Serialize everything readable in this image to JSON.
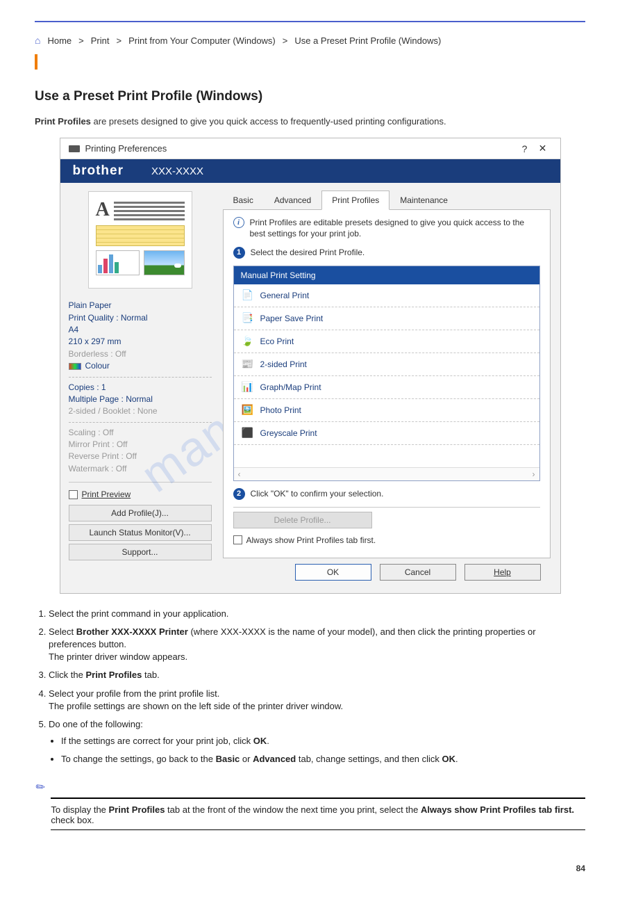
{
  "breadcrumb": {
    "root": "Home",
    "sep": ">",
    "cat": "Print",
    "sub": "Print from Your Computer (Windows)",
    "leaf": "Use a Preset Print Profile (Windows)"
  },
  "heading": "Use a Preset Print Profile (Windows)",
  "desc_pre": "Print Profiles",
  "desc_post": " are presets designed to give you quick access to frequently-used printing configurations.",
  "dialog": {
    "title": "Printing Preferences",
    "brand": "brother",
    "model": "XXX-XXXX",
    "summary": {
      "paper": "Plain Paper",
      "quality": "Print Quality : Normal",
      "size": "A4",
      "dims": "210 x 297 mm",
      "borderless": "Borderless : Off",
      "colour": "Colour",
      "copies": "Copies : 1",
      "multi": "Multiple Page : Normal",
      "booklet": "2-sided / Booklet : None",
      "scaling": "Scaling : Off",
      "mirror": "Mirror Print : Off",
      "reverse": "Reverse Print : Off",
      "watermark": "Watermark : Off"
    },
    "printPreview": "Print Preview",
    "addProfile": "Add Profile(J)...",
    "launchMonitor": "Launch Status Monitor(V)...",
    "support": "Support...",
    "tabs": {
      "basic": "Basic",
      "advanced": "Advanced",
      "profiles": "Print Profiles",
      "maint": "Maintenance"
    },
    "infoText": "Print Profiles are editable presets designed to give you quick access to the best settings for your print job.",
    "step1": "Select the desired Print Profile.",
    "step2": "Click \"OK\" to confirm your selection.",
    "profilesList": {
      "p0": "Manual Print Setting",
      "p1": "General Print",
      "p2": "Paper Save Print",
      "p3": "Eco Print",
      "p4": "2-sided Print",
      "p5": "Graph/Map Print",
      "p6": "Photo Print",
      "p7": "Greyscale Print"
    },
    "delete": "Delete Profile...",
    "always": "Always show Print Profiles tab first.",
    "ok": "OK",
    "cancel": "Cancel",
    "help": "Help"
  },
  "watermark": "manualshive.com",
  "steps": {
    "s1a": "Select the print command in your application.",
    "s2a": "Select ",
    "s2b": "Brother XXX-XXXX Printer",
    "s2c": " (where XXX-XXXX is the name of your model), and then click the printing properties or preferences button.",
    "s2d": "The printer driver window appears.",
    "s3a": "Click the ",
    "s3b": "Print Profiles",
    "s3c": " tab.",
    "s4a": "Select your profile from the print profile list.",
    "s4b": "The profile settings are shown on the left side of the printer driver window.",
    "s5a": "Do one of the following:",
    "s5b": "If the settings are correct for your print job, click ",
    "s5c": "OK",
    "s5d": ".",
    "s5e": "To change the settings, go back to the ",
    "s5f": "Basic",
    "s5g": " or ",
    "s5h": "Advanced",
    "s5i": " tab, change settings, and then click ",
    "s5j": "OK",
    "s5k": "."
  },
  "note": {
    "a": "To display the ",
    "b": "Print Profiles",
    "c": " tab at the front of the window the next time you print, select the ",
    "d": "Always show Print Profiles tab first.",
    "e": " check box."
  },
  "pagenum": "84"
}
